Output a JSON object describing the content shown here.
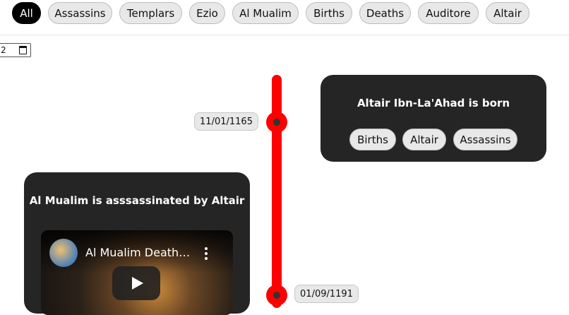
{
  "filters": [
    "All",
    "Assassins",
    "Templars",
    "Ezio",
    "Al Mualim",
    "Births",
    "Deaths",
    "Auditore",
    "Altair"
  ],
  "active_filter": "All",
  "date_input": {
    "value": "2"
  },
  "events": [
    {
      "date": "11/01/1165",
      "title": "Altair Ibn-La'Ahad is born",
      "tags": [
        "Births",
        "Altair",
        "Assassins"
      ]
    },
    {
      "date": "01/09/1191",
      "title": "Al Mualim is asssassinated by Altair",
      "video": {
        "title": "Al Mualim Death…",
        "channel_icon": "channel-avatar-icon"
      }
    }
  ],
  "colors": {
    "timeline": "#ff0000",
    "card_bg": "#252525",
    "chip_bg": "#e8e8e8",
    "active_chip_bg": "#000000"
  }
}
